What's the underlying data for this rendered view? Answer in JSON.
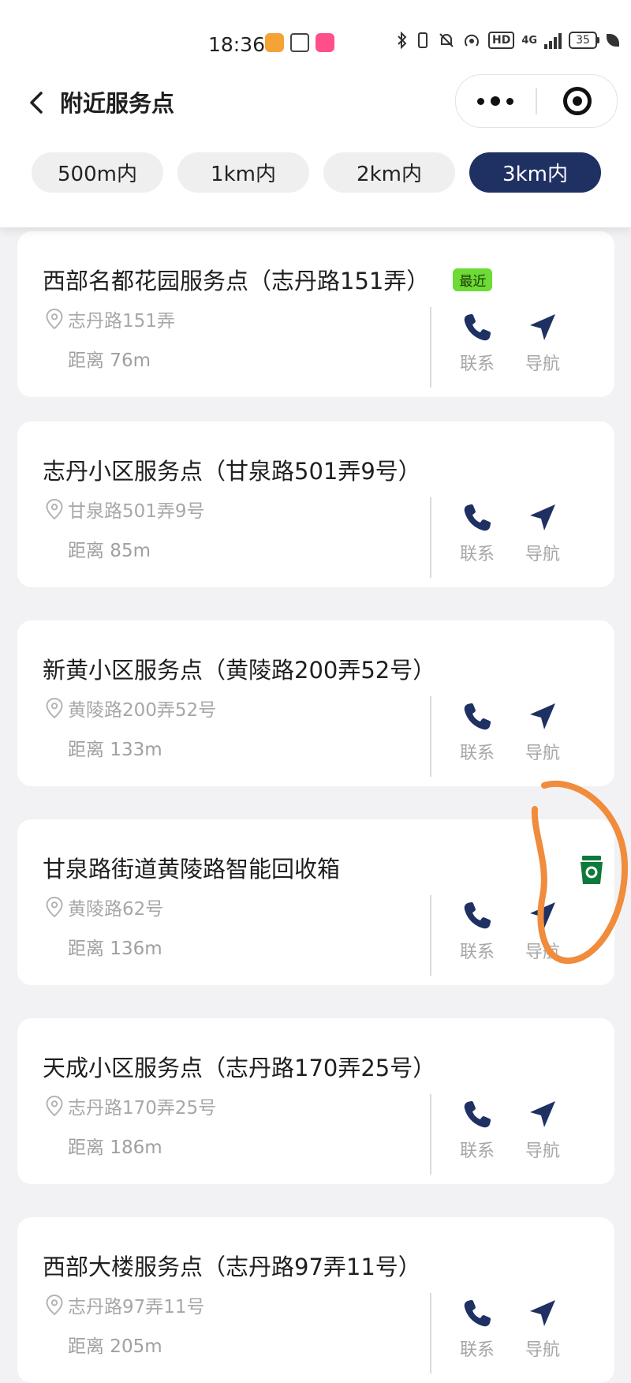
{
  "status_bar": {
    "time": "18:36",
    "network": "4G",
    "hd": "HD",
    "battery": "35",
    "icons": [
      "bluetooth-icon",
      "vibrate-icon",
      "mute-icon",
      "hotspot-icon",
      "signal-icon",
      "battery-icon",
      "leaf-icon"
    ]
  },
  "nav": {
    "title": "附近服务点",
    "back_icon": "chevron-left-icon",
    "more_icon": "more-dots-icon",
    "close_icon": "target-close-icon"
  },
  "filters": [
    {
      "label": "500m内",
      "active": false
    },
    {
      "label": "1km内",
      "active": false
    },
    {
      "label": "2km内",
      "active": false
    },
    {
      "label": "3km内",
      "active": true
    }
  ],
  "colors": {
    "accent": "#1f3063",
    "badge_green": "#6cdb35",
    "recycle_green": "#0d7a3a",
    "annotation_orange": "#f08c3c"
  },
  "actions": {
    "call_label": "联系",
    "nav_label": "导航"
  },
  "points": [
    {
      "name": "西部名都花园服务点（志丹路151弄）",
      "badge": "最近",
      "address": "志丹路151弄",
      "distance": "距离 76m"
    },
    {
      "name": "志丹小区服务点（甘泉路501弄9号）",
      "address": "甘泉路501弄9号",
      "distance": "距离 85m"
    },
    {
      "name": "新黄小区服务点（黄陵路200弄52号）",
      "address": "黄陵路200弄52号",
      "distance": "距离 133m"
    },
    {
      "name": "甘泉路街道黄陵路智能回收箱",
      "address": "黄陵路62号",
      "distance": "距离 136m",
      "icon": "recycle-bin-icon"
    },
    {
      "name": "天成小区服务点（志丹路170弄25号）",
      "address": "志丹路170弄25号",
      "distance": "距离 186m"
    },
    {
      "name": "西部大楼服务点（志丹路97弄11号）",
      "address": "志丹路97弄11号",
      "distance": "距离 205m"
    }
  ]
}
